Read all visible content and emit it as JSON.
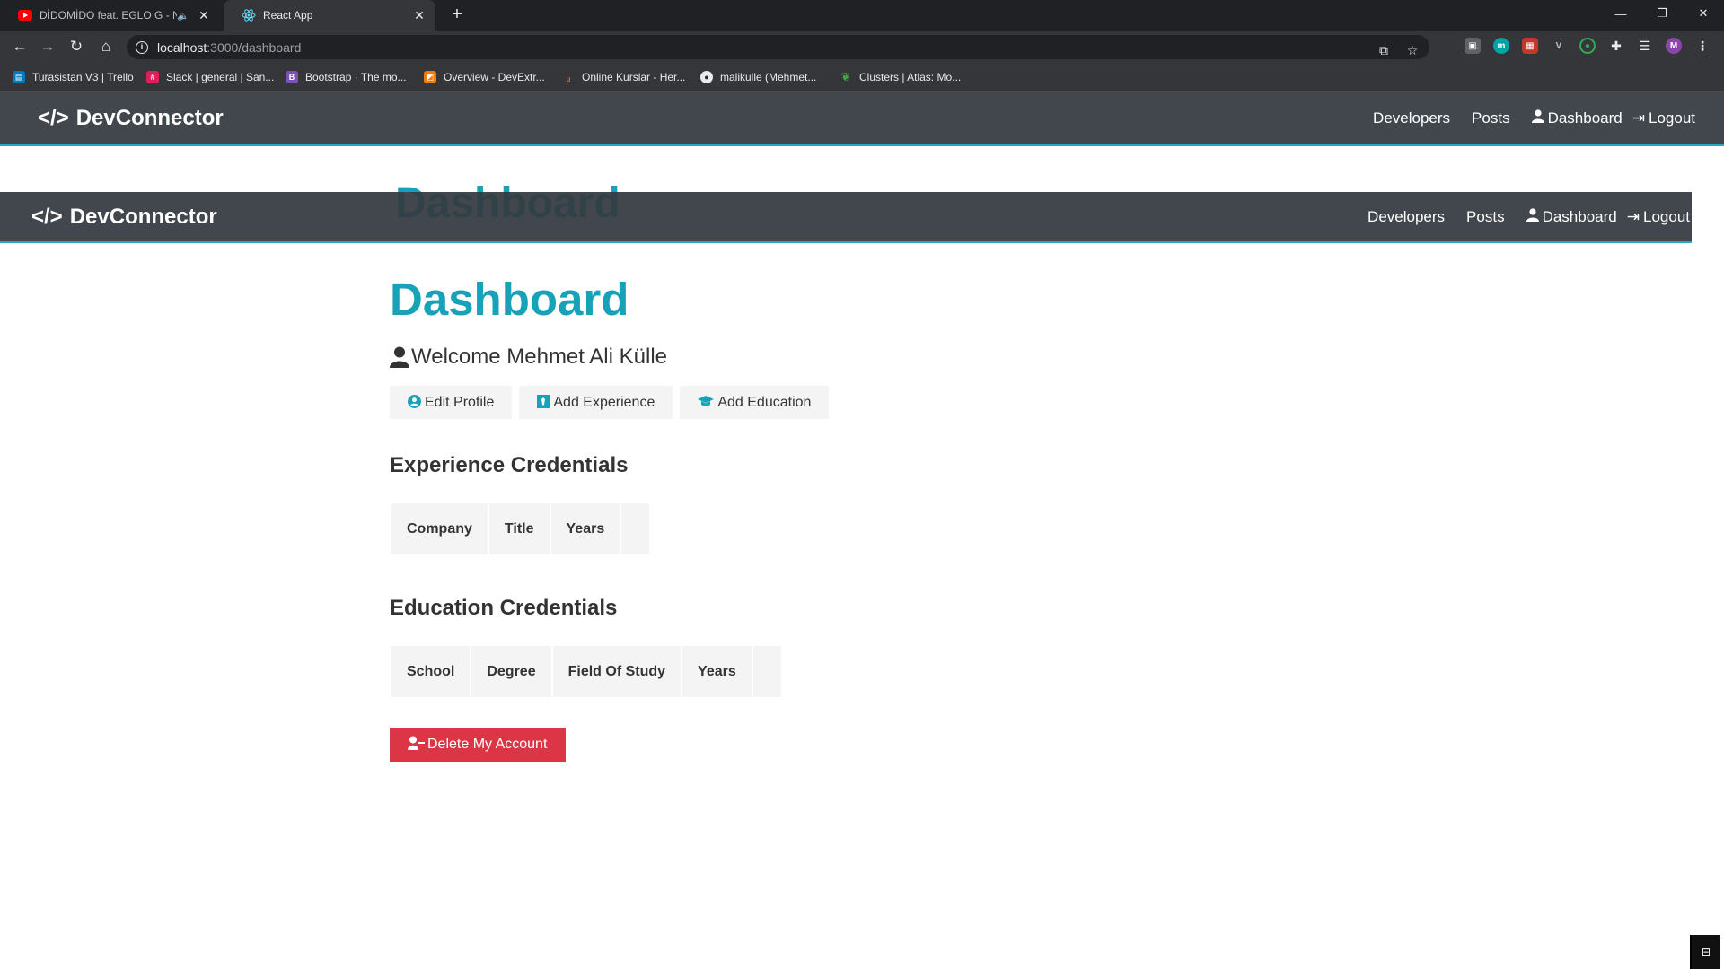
{
  "browser": {
    "tabs": [
      {
        "title": "DİDOMİDO feat. EGLO G - N",
        "favicon": "youtube-icon",
        "audio": "speaker-icon"
      },
      {
        "title": "React App",
        "favicon": "react-icon"
      }
    ],
    "address": {
      "host": "localhost",
      "path": ":3000/dashboard"
    },
    "profile_initial": "M",
    "bookmarks": [
      {
        "label": "Turasistan V3 | Trello",
        "icon": "trello-icon",
        "color": "#0079bf"
      },
      {
        "label": "Slack | general | San...",
        "icon": "slack-icon",
        "color": "#e01e5a"
      },
      {
        "label": "Bootstrap · The mo...",
        "icon": "bootstrap-icon",
        "color": "#7952b3"
      },
      {
        "label": "Overview - DevExtr...",
        "icon": "devextreme-icon",
        "color": "#f57c00"
      },
      {
        "label": "Online Kurslar - Her...",
        "icon": "udemy-icon",
        "color": "#ec5252"
      },
      {
        "label": "malikulle (Mehmet...",
        "icon": "github-icon",
        "color": "#24292e"
      },
      {
        "label": "Clusters | Atlas: Mo...",
        "icon": "mongodb-leaf-icon",
        "color": "#47a248"
      }
    ]
  },
  "app": {
    "brand": "DevConnector",
    "nav": {
      "developers": "Developers",
      "posts": "Posts",
      "dashboard": "Dashboard",
      "logout": "Logout"
    },
    "ghost_title": "Dashboard",
    "page_title": "Dashboard",
    "welcome": "Welcome Mehmet Ali Külle",
    "buttons": {
      "edit_profile": "Edit Profile",
      "add_experience": "Add Experience",
      "add_education": "Add Education",
      "delete_account": "Delete My Account"
    },
    "experience": {
      "heading": "Experience Credentials",
      "columns": [
        "Company",
        "Title",
        "Years"
      ]
    },
    "education": {
      "heading": "Education Credentials",
      "columns": [
        "School",
        "Degree",
        "Field Of Study",
        "Years"
      ]
    }
  },
  "colors": {
    "primary": "#17a2b8",
    "dark": "#343a40",
    "light": "#f4f4f4",
    "danger": "#dc3545"
  }
}
